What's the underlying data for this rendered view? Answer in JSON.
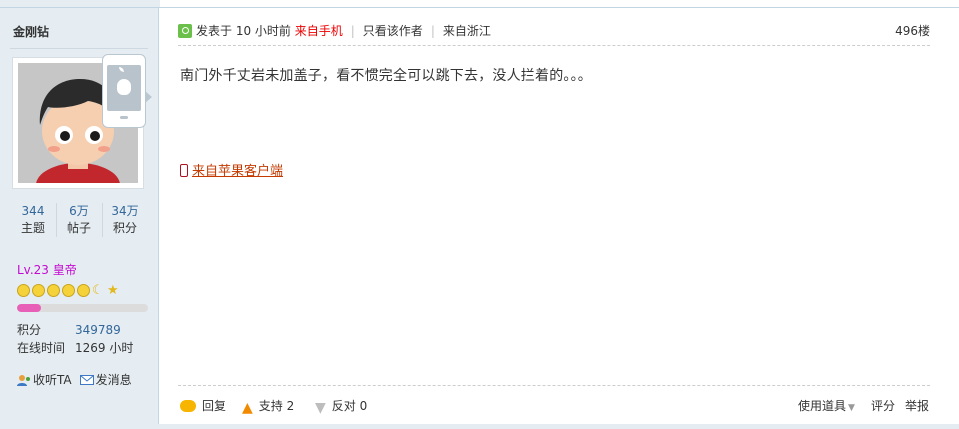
{
  "user": {
    "name": "金刚钻",
    "stats": [
      {
        "value": "344",
        "label": "主题"
      },
      {
        "value": "6万",
        "label": "帖子"
      },
      {
        "value": "34万",
        "label": "积分"
      }
    ],
    "level": "Lv.23 皇帝",
    "exp_fraction": 0.18,
    "info": [
      {
        "key": "积分",
        "value": "349789"
      },
      {
        "key": "在线时间",
        "value": "1269 小时"
      }
    ],
    "actions": {
      "follow": "收听TA",
      "message": "发消息"
    }
  },
  "post": {
    "posted": "发表于 10 小时前",
    "from_mobile": "来自手机",
    "only_author": "只看该作者",
    "location": "来自浙江",
    "floor": "496楼",
    "content": "南门外千丈岩未加盖子，看不惯完全可以跳下去，没人拦着的。。。",
    "client_link": "来自苹果客户端"
  },
  "bottom": {
    "reply": "回复",
    "support": "支持 2",
    "oppose": "反对 0",
    "tools": "使用道具",
    "rate": "评分",
    "report": "举报"
  },
  "colors": {
    "sidebar_bg": "#e5edf2",
    "link_blue": "#336699",
    "level_color": "#c309cf",
    "exp_fill": "#e85fb8",
    "mobile_red": "#ee0000",
    "client_link": "#c43a00"
  },
  "icons": [
    "apple-phone-icon",
    "clock-icon",
    "phone-icon",
    "reply-bubble-icon",
    "arrow-up-icon",
    "arrow-down-icon",
    "follow-icon",
    "mail-icon"
  ]
}
